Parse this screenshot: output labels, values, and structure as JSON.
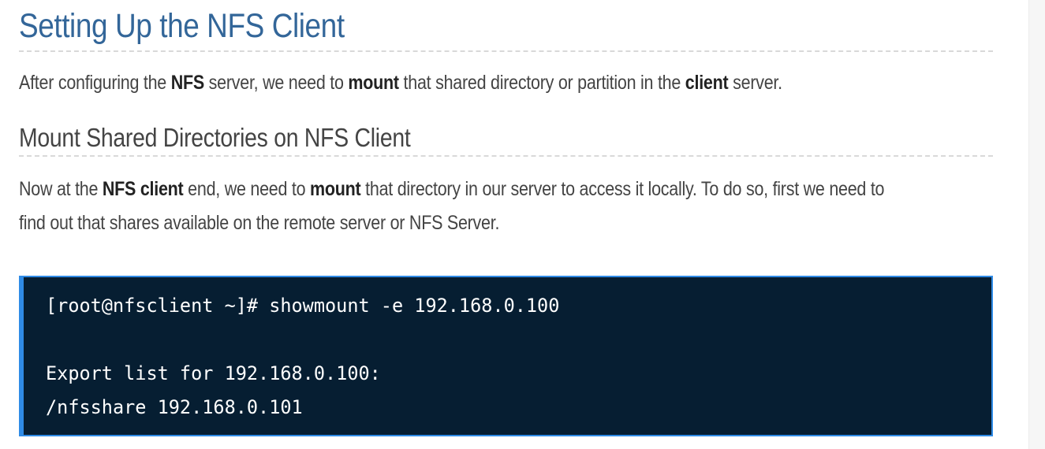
{
  "section": {
    "title": "Setting Up the NFS Client",
    "intro": {
      "t1": "After configuring the ",
      "b1": "NFS",
      "t2": " server, we need to ",
      "b2": "mount",
      "t3": " that shared directory or partition in the ",
      "b3": "client",
      "t4": " server."
    }
  },
  "subsection": {
    "title": "Mount Shared Directories on NFS Client",
    "para": {
      "t1": "Now at the ",
      "b1": "NFS client",
      "t2": " end, we need to ",
      "b2": "mount",
      "t3": " that directory in our server to access it locally. To do so, first we need to",
      "line2": "find out that shares available on the remote server or NFS Server."
    }
  },
  "code": {
    "lines": [
      "[root@nfsclient ~]# showmount -e 192.168.0.100",
      "",
      "Export list for 192.168.0.100:",
      "/nfsshare 192.168.0.101"
    ]
  }
}
